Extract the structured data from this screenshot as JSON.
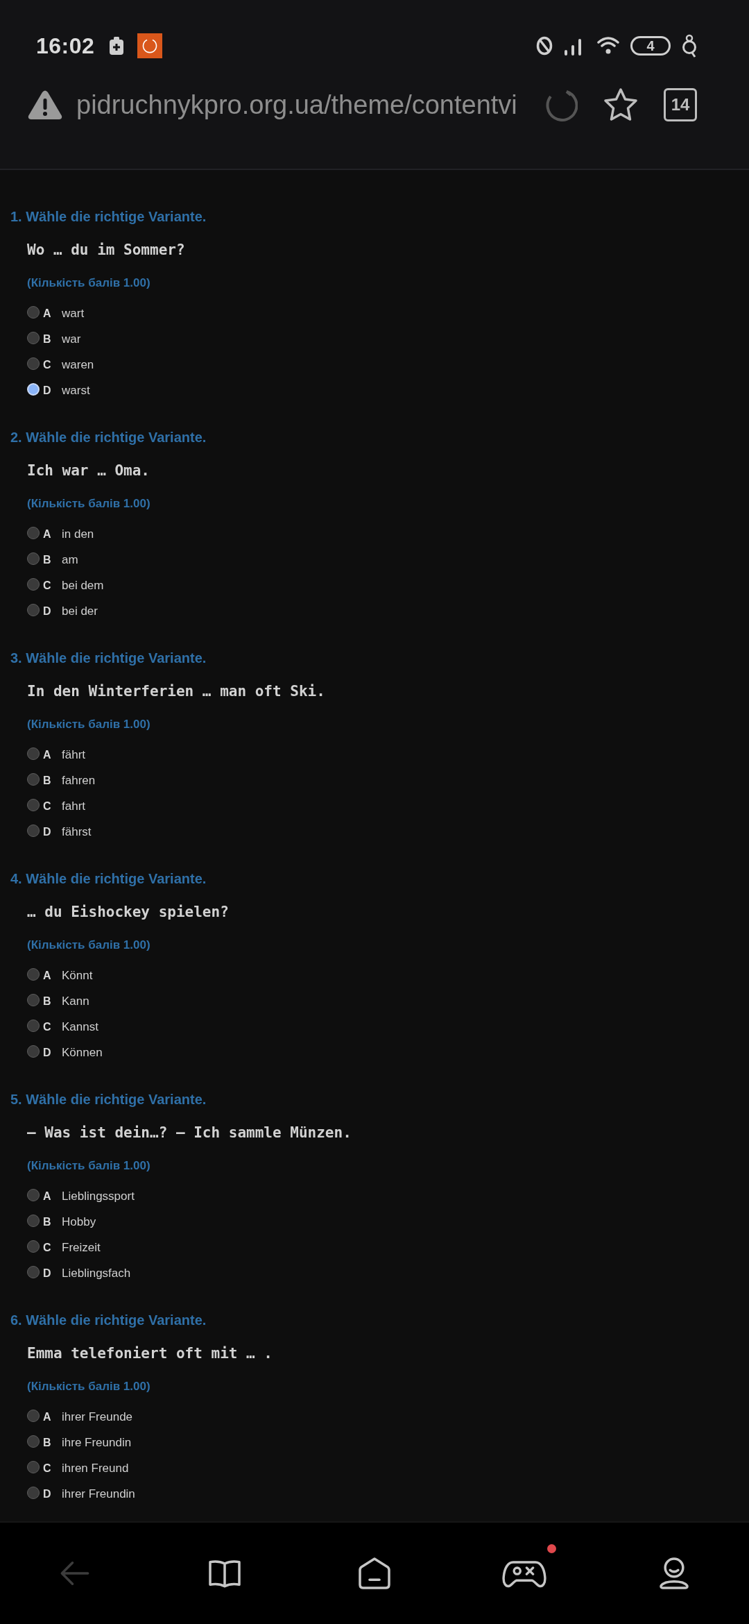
{
  "status_bar": {
    "time": "16:02",
    "battery": "4"
  },
  "address_bar": {
    "url": "pidruchnykpro.org.ua/theme/contentvi",
    "tab_count": "14"
  },
  "questions": [
    {
      "title": "1. Wähle die richtige Variante.",
      "text": "Wo … du im Sommer?",
      "points": "(Кількість балів 1.00)",
      "options": [
        {
          "letter": "A",
          "label": "wart",
          "selected": false
        },
        {
          "letter": "B",
          "label": "war",
          "selected": false
        },
        {
          "letter": "C",
          "label": "waren",
          "selected": false
        },
        {
          "letter": "D",
          "label": "warst",
          "selected": true
        }
      ]
    },
    {
      "title": "2. Wähle die richtige Variante.",
      "text": "Ich war … Oma.",
      "points": "(Кількість балів 1.00)",
      "options": [
        {
          "letter": "A",
          "label": "in den",
          "selected": false
        },
        {
          "letter": "B",
          "label": "am",
          "selected": false
        },
        {
          "letter": "C",
          "label": "bei dem",
          "selected": false
        },
        {
          "letter": "D",
          "label": "bei der",
          "selected": false
        }
      ]
    },
    {
      "title": "3. Wähle die richtige Variante.",
      "text": "In den Winterferien … man oft Ski.",
      "points": "(Кількість балів 1.00)",
      "options": [
        {
          "letter": "A",
          "label": "fährt",
          "selected": false
        },
        {
          "letter": "B",
          "label": "fahren",
          "selected": false
        },
        {
          "letter": "C",
          "label": "fahrt",
          "selected": false
        },
        {
          "letter": "D",
          "label": "fährst",
          "selected": false
        }
      ]
    },
    {
      "title": "4. Wähle die richtige Variante.",
      "text": "… du Eishockey spielen?",
      "points": "(Кількість балів 1.00)",
      "options": [
        {
          "letter": "A",
          "label": "Könnt",
          "selected": false
        },
        {
          "letter": "B",
          "label": "Kann",
          "selected": false
        },
        {
          "letter": "C",
          "label": "Kannst",
          "selected": false
        },
        {
          "letter": "D",
          "label": "Können",
          "selected": false
        }
      ]
    },
    {
      "title": "5. Wähle die richtige Variante.",
      "text": "— Was ist dein…? — Ich sammle Münzen.",
      "points": "(Кількість балів 1.00)",
      "options": [
        {
          "letter": "A",
          "label": "Lieblingssport",
          "selected": false
        },
        {
          "letter": "B",
          "label": "Hobby",
          "selected": false
        },
        {
          "letter": "C",
          "label": "Freizeit",
          "selected": false
        },
        {
          "letter": "D",
          "label": "Lieblingsfach",
          "selected": false
        }
      ]
    },
    {
      "title": "6. Wähle die richtige Variante.",
      "text": "Emma telefoniert oft mit … .",
      "points": "(Кількість балів 1.00)",
      "options": [
        {
          "letter": "A",
          "label": "ihrer Freunde",
          "selected": false
        },
        {
          "letter": "B",
          "label": "ihre Freundin",
          "selected": false
        },
        {
          "letter": "C",
          "label": "ihren Freund",
          "selected": false
        },
        {
          "letter": "D",
          "label": "ihrer Freundin",
          "selected": false
        }
      ]
    }
  ],
  "bottom_nav": [
    {
      "disabled": true,
      "badge": false
    },
    {
      "disabled": false,
      "badge": false
    },
    {
      "disabled": false,
      "badge": false
    },
    {
      "disabled": false,
      "badge": true
    },
    {
      "disabled": false,
      "badge": false
    }
  ]
}
